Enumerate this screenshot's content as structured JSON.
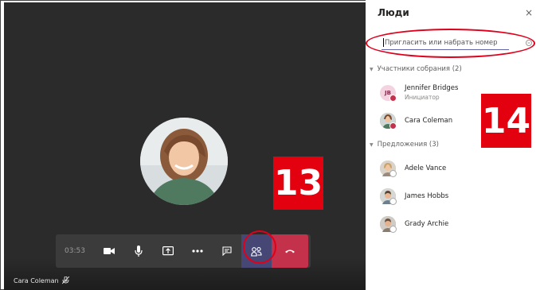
{
  "call": {
    "timer": "03:53",
    "caller_name": "Cara Coleman"
  },
  "badges": {
    "left": "13",
    "right": "14"
  },
  "panel": {
    "title": "Люди",
    "close": "×",
    "invite_placeholder": "Пригласить или набрать номер",
    "participants_header": "Участники собрания (2)",
    "participants": [
      {
        "name": "Jennifer Bridges",
        "role": "Инициатор",
        "initials": "JB"
      },
      {
        "name": "Cara Coleman",
        "role": ""
      }
    ],
    "suggestions_header": "Предложения (3)",
    "suggestions": [
      {
        "name": "Adele Vance"
      },
      {
        "name": "James Hobbs"
      },
      {
        "name": "Grady Archie"
      }
    ]
  },
  "colors": {
    "stage_bg": "#2b2b2b",
    "call_bar_bg": "#3b3b3b",
    "people_button_bg": "#464775",
    "hangup_bg": "#c4314b",
    "highlight": "#e0001b",
    "badge_red": "#e3000f",
    "accent": "#6264a7"
  }
}
